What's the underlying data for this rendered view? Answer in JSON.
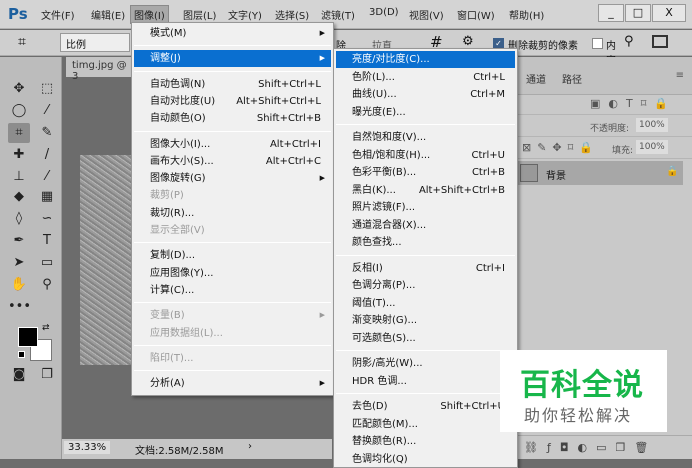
{
  "app": {
    "logo": "Ps"
  },
  "menubar": [
    "文件(F)",
    "编辑(E)",
    "图像(I)",
    "图层(L)",
    "文字(Y)",
    "选择(S)",
    "滤镜(T)",
    "3D(D)",
    "视图(V)",
    "窗口(W)",
    "帮助(H)"
  ],
  "window_buttons": {
    "minimize": "_",
    "maximize": "□",
    "close": "X"
  },
  "options": {
    "crop_icon": "crop-icon",
    "ratio": "比例",
    "clear": "除",
    "straighten": "拉直",
    "delete_cropped": "删除裁剪的像素",
    "content_aware": "内容"
  },
  "document": {
    "tab": "timg.jpg @ 3",
    "zoom": "33.33%",
    "doc_size": "文档:2.58M/2.58M"
  },
  "image_menu": [
    {
      "label": "模式(M)",
      "arrow": true
    },
    {
      "sep": true
    },
    {
      "label": "调整(J)",
      "arrow": true,
      "hl": true
    },
    {
      "sep": true
    },
    {
      "label": "自动色调(N)",
      "sc": "Shift+Ctrl+L"
    },
    {
      "label": "自动对比度(U)",
      "sc": "Alt+Shift+Ctrl+L"
    },
    {
      "label": "自动颜色(O)",
      "sc": "Shift+Ctrl+B"
    },
    {
      "sep": true
    },
    {
      "label": "图像大小(I)...",
      "sc": "Alt+Ctrl+I"
    },
    {
      "label": "画布大小(S)...",
      "sc": "Alt+Ctrl+C"
    },
    {
      "label": "图像旋转(G)",
      "arrow": true
    },
    {
      "label": "裁剪(P)",
      "dis": true
    },
    {
      "label": "裁切(R)..."
    },
    {
      "label": "显示全部(V)",
      "dis": true
    },
    {
      "sep": true
    },
    {
      "label": "复制(D)..."
    },
    {
      "label": "应用图像(Y)..."
    },
    {
      "label": "计算(C)..."
    },
    {
      "sep": true
    },
    {
      "label": "变量(B)",
      "dis": true,
      "arrow": true
    },
    {
      "label": "应用数据组(L)...",
      "dis": true
    },
    {
      "sep": true
    },
    {
      "label": "陷印(T)...",
      "dis": true
    },
    {
      "sep": true
    },
    {
      "label": "分析(A)",
      "arrow": true
    }
  ],
  "adjust_menu": [
    {
      "label": "亮度/对比度(C)...",
      "hl": true
    },
    {
      "label": "色阶(L)...",
      "sc": "Ctrl+L"
    },
    {
      "label": "曲线(U)...",
      "sc": "Ctrl+M"
    },
    {
      "label": "曝光度(E)..."
    },
    {
      "sep": true
    },
    {
      "label": "自然饱和度(V)..."
    },
    {
      "label": "色相/饱和度(H)...",
      "sc": "Ctrl+U"
    },
    {
      "label": "色彩平衡(B)...",
      "sc": "Ctrl+B"
    },
    {
      "label": "黑白(K)...",
      "sc": "Alt+Shift+Ctrl+B"
    },
    {
      "label": "照片滤镜(F)..."
    },
    {
      "label": "通道混合器(X)..."
    },
    {
      "label": "颜色查找..."
    },
    {
      "sep": true
    },
    {
      "label": "反相(I)",
      "sc": "Ctrl+I"
    },
    {
      "label": "色调分离(P)..."
    },
    {
      "label": "阈值(T)..."
    },
    {
      "label": "渐变映射(G)..."
    },
    {
      "label": "可选颜色(S)..."
    },
    {
      "sep": true
    },
    {
      "label": "阴影/高光(W)..."
    },
    {
      "label": "HDR 色调..."
    },
    {
      "sep": true
    },
    {
      "label": "去色(D)",
      "sc": "Shift+Ctrl+U"
    },
    {
      "label": "匹配颜色(M)..."
    },
    {
      "label": "替换颜色(R)..."
    },
    {
      "label": "色调均化(Q)"
    }
  ],
  "panel": {
    "tabs": [
      "通道",
      "路径"
    ],
    "opacity_label": "不透明度:",
    "opacity": "100%",
    "fill_label": "填充:",
    "fill": "100%",
    "layer_name": "背景"
  },
  "watermark": {
    "title": "百科全说",
    "subtitle": "助你轻松解决"
  }
}
